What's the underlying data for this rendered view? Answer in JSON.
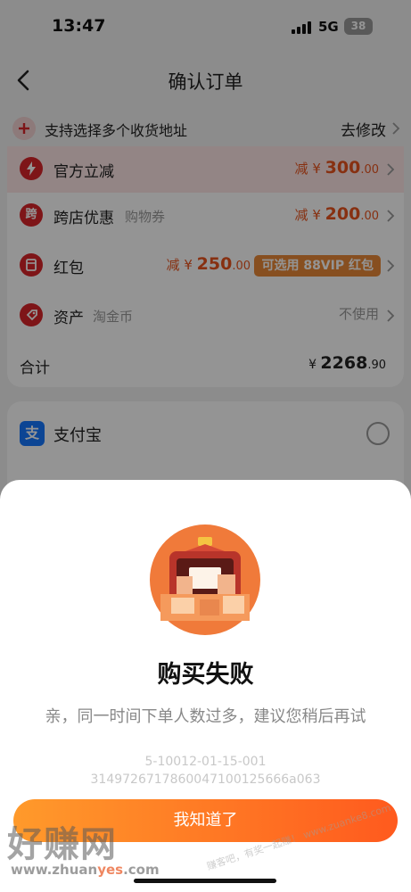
{
  "status_bar": {
    "time": "13:47",
    "network": "5G",
    "battery": "38"
  },
  "header": {
    "title": "确认订单"
  },
  "address": {
    "text": "支持选择多个收货地址",
    "modify": "去修改"
  },
  "discounts": [
    {
      "label": "官方立减",
      "sub": "",
      "prefix": "减 ¥ ",
      "amount": "300",
      "decimal": ".00",
      "icon": "lightning-icon"
    },
    {
      "label": "跨店优惠",
      "sub": "购物券",
      "prefix": "减 ¥ ",
      "amount": "200",
      "decimal": ".00",
      "icon_text": "跨"
    },
    {
      "label": "红包",
      "sub": "",
      "prefix": "减 ¥ ",
      "amount": "250",
      "decimal": ".00",
      "badge": "可选用 88VIP 红包",
      "icon": "redpacket-icon"
    },
    {
      "label": "资产",
      "sub": "淘金币",
      "value": "不使用",
      "icon": "coin-tag-icon"
    }
  ],
  "total": {
    "label": "合计",
    "currency": "¥ ",
    "amount": "2268",
    "decimal": ".90"
  },
  "payment": {
    "method": "支付宝",
    "icon_text": "支"
  },
  "dialog": {
    "title": "购买失败",
    "message": "亲，同一时间下单人数过多，建议您稍后再试",
    "code_line1": "5-10012-01-15-001",
    "code_line2": "3149726717860047100125666a063",
    "button": "我知道了"
  },
  "watermark": {
    "logo": "好赚网",
    "url_a": "www.zhuan",
    "url_b": "yes",
    "url_c": ".com",
    "right": "赚客吧，有奖一起赚！ www.zuanke8.com"
  },
  "colors": {
    "accent": "#e8541e",
    "button_start": "#ff9a2b",
    "button_end": "#ff5a1e",
    "vip_badge": "#e98838",
    "alipay": "#1677ff"
  }
}
